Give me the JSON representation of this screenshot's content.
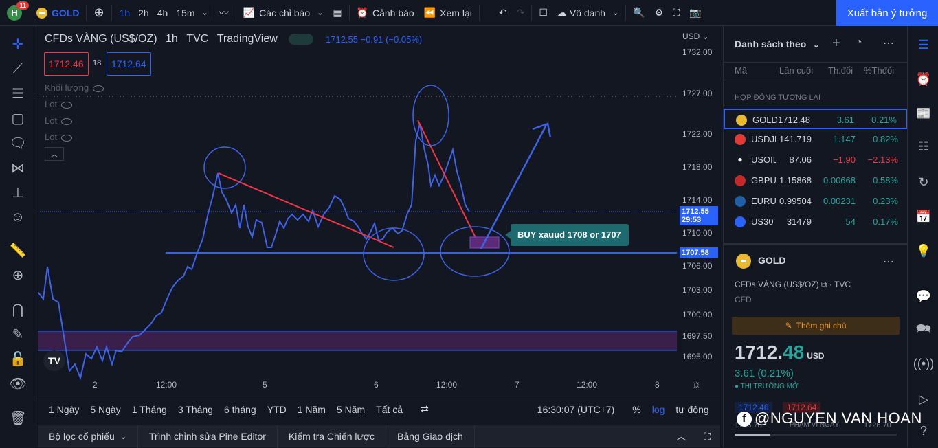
{
  "topbar": {
    "avatar_letter": "H",
    "notif_count": "11",
    "symbol": "GOLD",
    "intervals": [
      "1h",
      "2h",
      "4h",
      "15m"
    ],
    "indicators_label": "Các chỉ báo",
    "alert_label": "Cảnh báo",
    "replay_label": "Xem lại",
    "layout_label": "Vô danh",
    "publish_label": "Xuất bản ý tưởng"
  },
  "chart": {
    "title": "CFDs VÀNG (US$/OZ)",
    "interval": "1h",
    "source": "TVC",
    "brand": "TradingView",
    "last_change": "1712.55  −0.91 (−0.05%)",
    "sell_price": "1712.46",
    "spread": "18",
    "buy_price": "1712.64",
    "volume_label": "Khối lượng",
    "lot_labels": [
      "Lot",
      "Lot",
      "Lot"
    ],
    "currency": "USD",
    "price_ticks": [
      "1732.00",
      "1727.00",
      "1722.00",
      "1718.00",
      "1714.00",
      "1710.00",
      "1706.00",
      "1703.00",
      "1700.00",
      "1697.50",
      "1695.00"
    ],
    "current_price": "1712.55",
    "countdown": "29:53",
    "line_price": "1707.58",
    "time_ticks": [
      "2",
      "12:00",
      "5",
      "6",
      "12:00",
      "7",
      "12:00",
      "8"
    ],
    "callout": "BUY xauud 1708 or 1707",
    "logo_text": "TV"
  },
  "rangebar": {
    "ranges": [
      "1 Ngày",
      "5 Ngày",
      "1 Tháng",
      "3 Tháng",
      "6 tháng",
      "YTD",
      "1 Năm",
      "5 Năm",
      "Tất cả"
    ],
    "clock": "16:30:07 (UTC+7)",
    "percent": "%",
    "log": "log",
    "auto": "tự động"
  },
  "bottombar": {
    "tabs": [
      "Bộ lọc cổ phiếu",
      "Trình chỉnh sửa Pine Editor",
      "Kiểm tra Chiến lược",
      "Bảng Giao dịch"
    ]
  },
  "watchlist": {
    "title": "Danh sách theo",
    "col_symbol": "Mã",
    "col_last": "Lần cuối",
    "col_change": "Th.đổi",
    "col_pct": "%Thđổi",
    "section": "HỢP ĐỒNG TƯƠNG LAI",
    "rows": [
      {
        "sym": "GOLD",
        "last": "1712.48",
        "chg": "3.61",
        "pct": "0.21%",
        "dir": "up",
        "color": "#e8b931"
      },
      {
        "sym": "USDJPY",
        "last": "141.719",
        "chg": "1.147",
        "pct": "0.82%",
        "dir": "up",
        "color": "#e53935"
      },
      {
        "sym": "USOIL",
        "last": "87.06",
        "chg": "−1.90",
        "pct": "−2.13%",
        "dir": "down",
        "color": "#131722"
      },
      {
        "sym": "GBPUSD",
        "last": "1.15868",
        "chg": "0.00668",
        "pct": "0.58%",
        "dir": "up",
        "color": "#c62828"
      },
      {
        "sym": "EURUSD",
        "last": "0.99504",
        "chg": "0.00231",
        "pct": "0.23%",
        "dir": "up",
        "color": "#1e5fa8"
      },
      {
        "sym": "US30",
        "last": "31479",
        "chg": "54",
        "pct": "0.17%",
        "dir": "up",
        "color": "#2962ff"
      }
    ]
  },
  "details": {
    "symbol": "GOLD",
    "name": "CFDs VÀNG (US$/OZ)",
    "source": "TVC",
    "type": "CFD",
    "note_label": "Thêm ghi chú",
    "price_main": "1712.",
    "price_tail": "48",
    "currency": "USD",
    "change": "3.61 (0.21%)",
    "market_status": "● THỊ TRƯỜNG MỞ",
    "bid": "1712.46",
    "ask": "1712.64",
    "range_label": "PHẠM VI NGÀY",
    "range_low": "1706.78",
    "range_high": "1726.70"
  },
  "watermark": "@NGUYEN VAN HOAN"
}
